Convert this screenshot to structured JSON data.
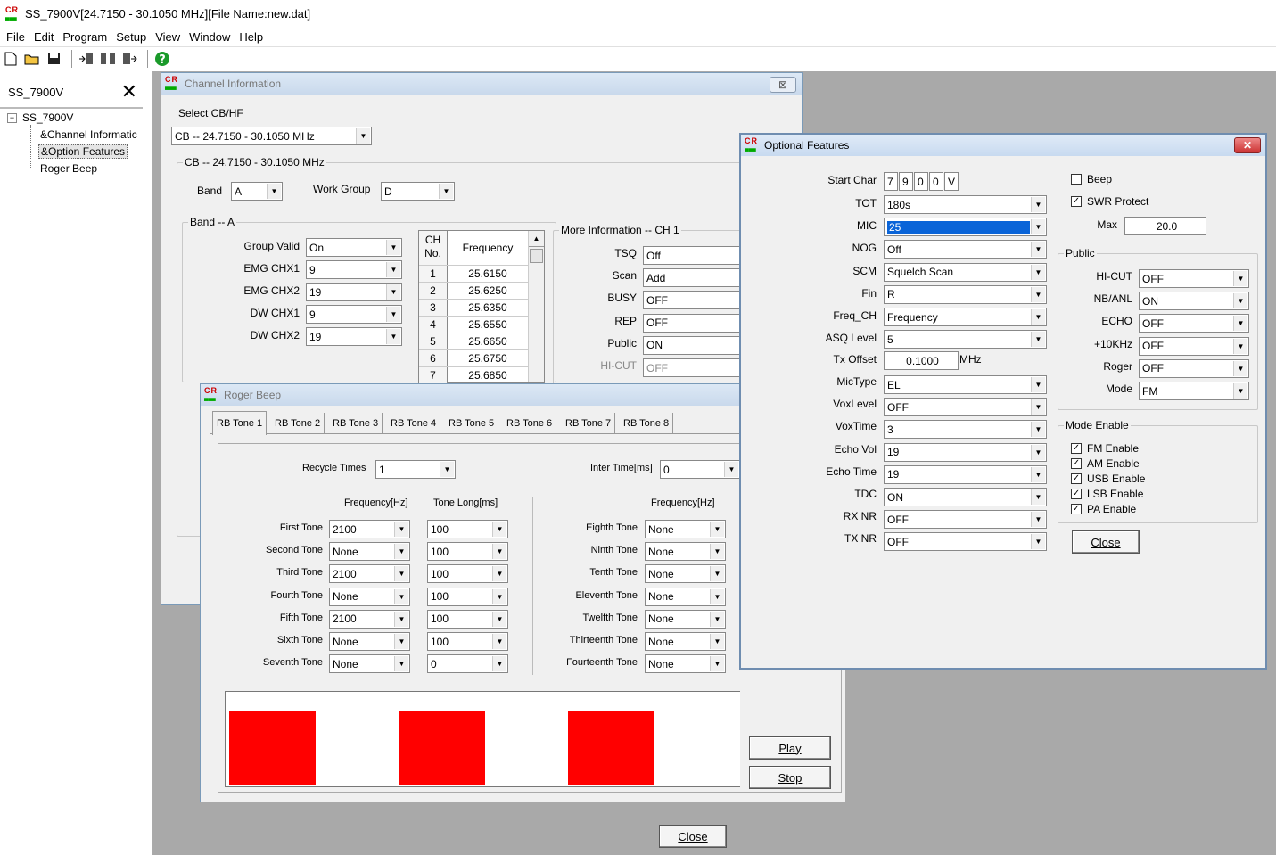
{
  "app": {
    "title": "SS_7900V[24.7150 - 30.1050 MHz][File Name:new.dat]"
  },
  "menu": [
    "File",
    "Edit",
    "Program",
    "Setup",
    "View",
    "Window",
    "Help"
  ],
  "sidebar": {
    "header": "SS_7900V",
    "root": "SS_7900V",
    "items": [
      "&Channel Informatic",
      "&Option Features",
      "Roger Beep"
    ]
  },
  "channel_window": {
    "title": "Channel Information",
    "select_label": "Select CB/HF",
    "select_value": "CB -- 24.7150 - 30.1050 MHz",
    "group_label": "CB -- 24.7150 - 30.1050 MHz",
    "band_label": "Band",
    "band_value": "A",
    "workgroup_label": "Work Group",
    "workgroup_value": "D",
    "band_group": "Band -- A",
    "fields": [
      {
        "label": "Group Valid",
        "value": "On"
      },
      {
        "label": "EMG CHX1",
        "value": "9"
      },
      {
        "label": "EMG CHX2",
        "value": "19"
      },
      {
        "label": "DW CHX1",
        "value": "9"
      },
      {
        "label": "DW CHX2",
        "value": "19"
      }
    ],
    "table_head_ch1": "CH",
    "table_head_ch2": "No.",
    "table_head_freq": "Frequency",
    "table": [
      {
        "ch": "1",
        "freq": "25.6150"
      },
      {
        "ch": "2",
        "freq": "25.6250"
      },
      {
        "ch": "3",
        "freq": "25.6350"
      },
      {
        "ch": "4",
        "freq": "25.6550"
      },
      {
        "ch": "5",
        "freq": "25.6650"
      },
      {
        "ch": "6",
        "freq": "25.6750"
      },
      {
        "ch": "7",
        "freq": "25.6850"
      }
    ],
    "more_info": "More Information -- CH 1",
    "more": [
      {
        "label": "TSQ",
        "value": "Off"
      },
      {
        "label": "Scan",
        "value": "Add"
      },
      {
        "label": "BUSY",
        "value": "OFF"
      },
      {
        "label": "REP",
        "value": "OFF"
      },
      {
        "label": "Public",
        "value": "ON"
      },
      {
        "label": "HI-CUT",
        "value": "OFF"
      }
    ],
    "close": "Close"
  },
  "roger_window": {
    "title": "Roger Beep",
    "tabs": [
      "RB Tone 1",
      "RB Tone 2",
      "RB Tone 3",
      "RB Tone 4",
      "RB Tone 5",
      "RB Tone 6",
      "RB Tone 7",
      "RB Tone 8"
    ],
    "recycle_label": "Recycle Times",
    "recycle_value": "1",
    "inter_label": "Inter Time[ms]",
    "inter_value": "0",
    "freq_head": "Frequency[Hz]",
    "tone_head": "Tone Long[ms]",
    "freq_head2": "Frequency[Hz]",
    "left_tones": [
      {
        "label": "First Tone",
        "freq": "2100",
        "long": "100"
      },
      {
        "label": "Second Tone",
        "freq": "None",
        "long": "100"
      },
      {
        "label": "Third Tone",
        "freq": "2100",
        "long": "100"
      },
      {
        "label": "Fourth Tone",
        "freq": "None",
        "long": "100"
      },
      {
        "label": "Fifth Tone",
        "freq": "2100",
        "long": "100"
      },
      {
        "label": "Sixth Tone",
        "freq": "None",
        "long": "100"
      },
      {
        "label": "Seventh Tone",
        "freq": "None",
        "long": "0"
      }
    ],
    "right_tones": [
      {
        "label": "Eighth Tone",
        "freq": "None"
      },
      {
        "label": "Ninth Tone",
        "freq": "None"
      },
      {
        "label": "Tenth Tone",
        "freq": "None"
      },
      {
        "label": "Eleventh Tone",
        "freq": "None"
      },
      {
        "label": "Twelfth Tone",
        "freq": "None"
      },
      {
        "label": "Thirteenth Tone",
        "freq": "None"
      },
      {
        "label": "Fourteenth Tone",
        "freq": "None"
      }
    ],
    "play": "Play",
    "stop": "Stop",
    "colors": {
      "bar": "#ff0000"
    }
  },
  "optional_window": {
    "title": "Optional Features",
    "start_char_label": "Start Char",
    "start_chars": [
      "7",
      "9",
      "0",
      "0",
      "V"
    ],
    "fields": [
      {
        "label": "TOT",
        "value": "180s"
      },
      {
        "label": "MIC",
        "value": "25"
      },
      {
        "label": "NOG",
        "value": "Off"
      },
      {
        "label": "SCM",
        "value": "Squelch Scan"
      },
      {
        "label": "Fin",
        "value": "R"
      },
      {
        "label": "Freq_CH",
        "value": "Frequency"
      },
      {
        "label": "ASQ Level",
        "value": "5"
      }
    ],
    "tx_offset_label": "Tx Offset",
    "tx_offset_value": "0.1000",
    "tx_offset_unit": "MHz",
    "fields2": [
      {
        "label": "MicType",
        "value": "EL"
      },
      {
        "label": "VoxLevel",
        "value": "OFF"
      },
      {
        "label": "VoxTime",
        "value": "3"
      },
      {
        "label": "Echo Vol",
        "value": "19"
      },
      {
        "label": "Echo Time",
        "value": "19"
      },
      {
        "label": "TDC",
        "value": "ON"
      },
      {
        "label": "RX NR",
        "value": "OFF"
      },
      {
        "label": "TX NR",
        "value": "OFF"
      }
    ],
    "beep": "Beep",
    "swr": "SWR Protect",
    "max_label": "Max",
    "max_value": "20.0",
    "public_group": "Public",
    "public": [
      {
        "label": "HI-CUT",
        "value": "OFF"
      },
      {
        "label": "NB/ANL",
        "value": "ON"
      },
      {
        "label": "ECHO",
        "value": "OFF"
      },
      {
        "label": "+10KHz",
        "value": "OFF"
      },
      {
        "label": "Roger",
        "value": "OFF"
      },
      {
        "label": "Mode",
        "value": "FM"
      }
    ],
    "mode_group": "Mode Enable",
    "modes": [
      "FM Enable",
      "AM Enable",
      "USB Enable",
      "LSB Enable",
      "PA Enable"
    ],
    "close": "Close"
  }
}
